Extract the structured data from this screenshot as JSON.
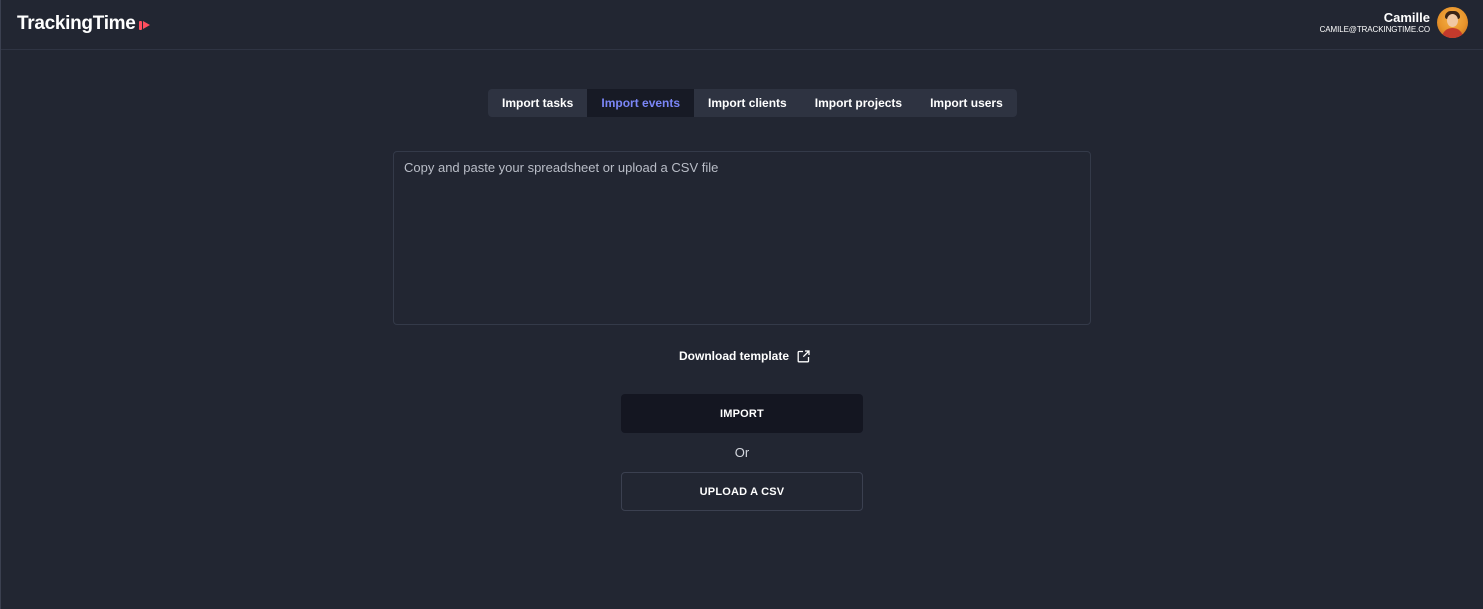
{
  "header": {
    "logo_text": "TrackingTime",
    "user": {
      "name": "Camille",
      "email": "CAMILE@TRACKINGTIME.CO"
    }
  },
  "tabs": [
    {
      "label": "Import tasks",
      "active": false
    },
    {
      "label": "Import events",
      "active": true
    },
    {
      "label": "Import clients",
      "active": false
    },
    {
      "label": "Import projects",
      "active": false
    },
    {
      "label": "Import users",
      "active": false
    }
  ],
  "paste_area": {
    "placeholder": "Copy and paste your spreadsheet or upload a CSV file",
    "value": ""
  },
  "download_template": {
    "label": "Download template",
    "icon": "external-link-icon"
  },
  "actions": {
    "import_label": "IMPORT",
    "or_label": "Or",
    "upload_label": "UPLOAD A CSV"
  },
  "colors": {
    "background": "#222632",
    "accent": "#7b86f7",
    "logo_mark": "#ff4e5e",
    "import_button": "#141621"
  }
}
